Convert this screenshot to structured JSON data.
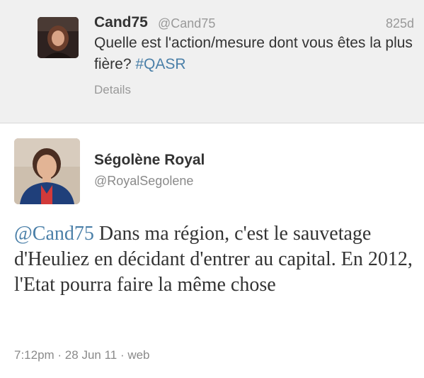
{
  "parent_tweet": {
    "display_name": "Cand75",
    "handle": "@Cand75",
    "age": "825d",
    "text_before": "Quelle est l'action/mesure dont vous êtes la plus fière? ",
    "hashtag": "#QASR",
    "details_label": "Details"
  },
  "main_tweet": {
    "display_name": "Ségolène Royal",
    "handle": "@RoyalSegolene",
    "mention": "@Cand75",
    "text": " Dans ma région, c'est le sauvetage d'Heuliez en décidant d'entrer au capital. En 2012, l'Etat pourra faire la même chose",
    "timestamp": "7:12pm · 28 Jun 11 · web"
  },
  "colors": {
    "link": "#4a7fa8",
    "parent_background": "#f0f0f0",
    "secondary_text": "#999999"
  }
}
